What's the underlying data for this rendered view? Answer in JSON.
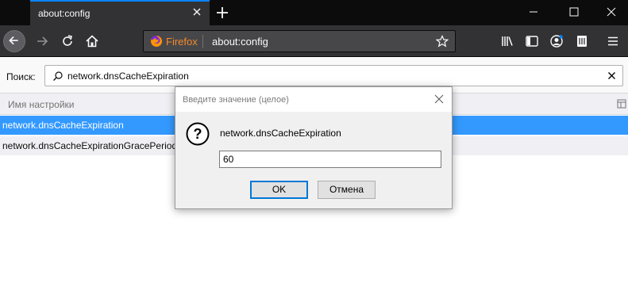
{
  "tab": {
    "title": "about:config"
  },
  "urlbar": {
    "brand": "Firefox",
    "url": "about:config"
  },
  "search": {
    "label": "Поиск:",
    "value": "network.dnsCacheExpiration"
  },
  "table": {
    "column_name": "Имя настройки",
    "rows": [
      {
        "name": "network.dnsCacheExpiration",
        "selected": true
      },
      {
        "name": "network.dnsCacheExpirationGracePeriod",
        "selected": false
      }
    ]
  },
  "dialog": {
    "title": "Введите значение (целое)",
    "message": "network.dnsCacheExpiration",
    "input_value": "60",
    "ok_label": "OK",
    "cancel_label": "Отмена"
  },
  "icons": {
    "tab_close": "close-icon",
    "new_tab": "plus-icon",
    "minimize": "minimize-icon",
    "maximize": "maximize-icon",
    "close_window": "close-icon",
    "back": "arrow-left-icon",
    "forward": "arrow-right-icon",
    "reload": "reload-icon",
    "home": "home-icon",
    "bookmark": "star-icon",
    "library": "library-icon",
    "sidebar": "sidebar-icon",
    "account": "account-icon",
    "extension": "extension-icon",
    "menu": "hamburger-menu-icon",
    "search": "search-icon",
    "clear": "clear-icon",
    "column_picker": "column-picker-icon",
    "question": "question-icon"
  },
  "colors": {
    "accent": "#0a84ff",
    "selection": "#3399ff",
    "firefox_orange": "#f58a2e"
  }
}
